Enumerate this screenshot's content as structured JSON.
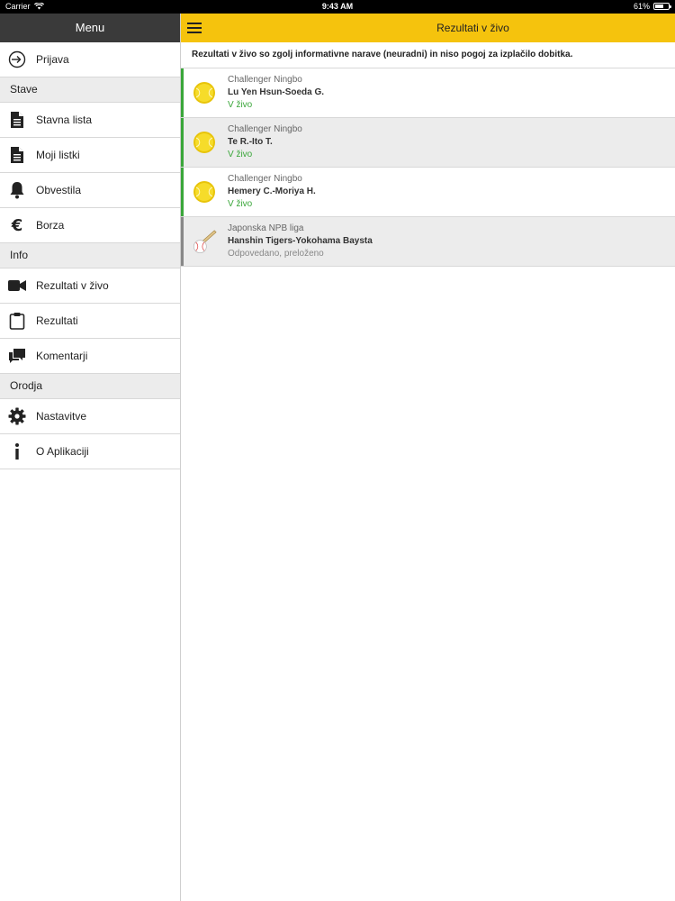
{
  "statusbar": {
    "carrier": "Carrier",
    "time": "9:43 AM",
    "battery": "61%",
    "battery_level": 0.61
  },
  "sidebar": {
    "header": "Menu",
    "login": "Prijava",
    "sections": [
      {
        "title": "Stave",
        "items": [
          "Stavna lista",
          "Moji listki",
          "Obvestila",
          "Borza"
        ]
      },
      {
        "title": "Info",
        "items": [
          "Rezultati v živo",
          "Rezultati",
          "Komentarji"
        ]
      },
      {
        "title": "Orodja",
        "items": [
          "Nastavitve",
          "O Aplikaciji"
        ]
      }
    ]
  },
  "navbar": {
    "title": "Rezultati v živo"
  },
  "notice": "Rezultati v živo so zgolj informativne narave (neuradni) in niso pogoj za izplačilo dobitka.",
  "results": [
    {
      "league": "Challenger Ningbo",
      "match": "Lu Yen Hsun-Soeda G.",
      "status": "V živo",
      "sport": "tennis-ball-icon"
    },
    {
      "league": "Challenger Ningbo",
      "match": "Te R.-Ito T.",
      "status": "V živo",
      "sport": "tennis-ball-icon"
    },
    {
      "league": "Challenger Ningbo",
      "match": "Hemery C.-Moriya H.",
      "status": "V živo",
      "sport": "tennis-ball-icon"
    },
    {
      "league": "Japonska NPB liga",
      "match": "Hanshin Tigers-Yokohama Baysta",
      "status": "Odpovedano, preloženo",
      "sport": "baseball-icon"
    }
  ],
  "colors": {
    "accent": "#f5c30d",
    "live_green": "#3aa63a",
    "cancelled_gray": "#888888",
    "sidebar_header": "#3a3a3a"
  }
}
